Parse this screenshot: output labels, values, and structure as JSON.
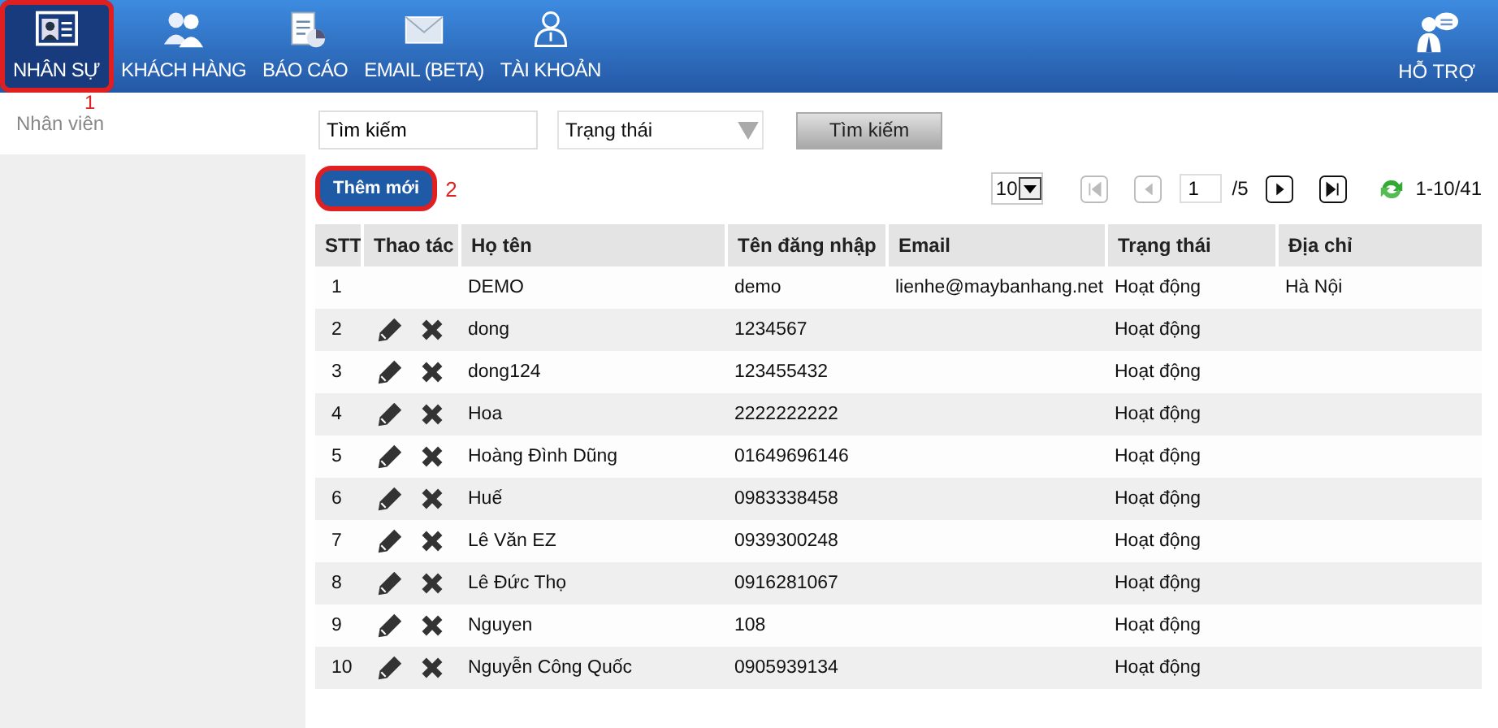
{
  "nav": [
    {
      "label": "NHÂN SỰ",
      "kind": "staff",
      "selected": true,
      "annotation": "1"
    },
    {
      "label": "KHÁCH HÀNG",
      "kind": "customers",
      "selected": false
    },
    {
      "label": "BÁO CÁO",
      "kind": "report",
      "selected": false
    },
    {
      "label": "EMAIL (BETA)",
      "kind": "mail",
      "selected": false
    },
    {
      "label": "TÀI KHOẢN",
      "kind": "account",
      "selected": false
    }
  ],
  "help": {
    "label": "HỖ TRỢ"
  },
  "sidebar": {
    "items": [
      {
        "label": "Nhân viên",
        "selected": false
      }
    ]
  },
  "filters": {
    "search": {
      "value": "Tìm kiếm"
    },
    "status": {
      "value": "Trạng thái"
    },
    "button": "Tìm kiếm"
  },
  "add_button": {
    "label": "Thêm mới",
    "annotation": "2"
  },
  "pagination": {
    "page_size": "10",
    "page": "1",
    "pages": "/5",
    "range": "1-10/41",
    "first_disabled": true,
    "prev_disabled": true,
    "next_disabled": false,
    "last_disabled": false
  },
  "table": {
    "columns": [
      "STT",
      "Thao tác",
      "Họ tên",
      "Tên đăng nhập",
      "Email",
      "Trạng thái",
      "Địa chỉ"
    ],
    "rows": [
      {
        "stt": "1",
        "editable": false,
        "name": "DEMO",
        "username": "demo",
        "email": "lienhe@maybanhang.net",
        "status": "Hoạt động",
        "address": "Hà Nội"
      },
      {
        "stt": "2",
        "editable": true,
        "name": "dong",
        "username": "1234567",
        "status": "Hoạt động"
      },
      {
        "stt": "3",
        "editable": true,
        "name": "dong124",
        "username": "123455432",
        "status": "Hoạt động"
      },
      {
        "stt": "4",
        "editable": true,
        "name": "Hoa",
        "username": "2222222222",
        "status": "Hoạt động"
      },
      {
        "stt": "5",
        "editable": true,
        "name": "Hoàng Đình Dũng",
        "username": "01649696146",
        "status": "Hoạt động"
      },
      {
        "stt": "6",
        "editable": true,
        "name": "Huế",
        "username": "0983338458",
        "status": "Hoạt động"
      },
      {
        "stt": "7",
        "editable": true,
        "name": "Lê Văn EZ",
        "username": "0939300248",
        "status": "Hoạt động"
      },
      {
        "stt": "8",
        "editable": true,
        "name": "Lê Đức Thọ",
        "username": "0916281067",
        "status": "Hoạt động"
      },
      {
        "stt": "9",
        "editable": true,
        "name": "Nguyen",
        "username": "108",
        "status": "Hoạt động"
      },
      {
        "stt": "10",
        "editable": true,
        "name": "Nguyễn Công Quốc",
        "username": "0905939134",
        "status": "Hoạt động"
      }
    ]
  }
}
